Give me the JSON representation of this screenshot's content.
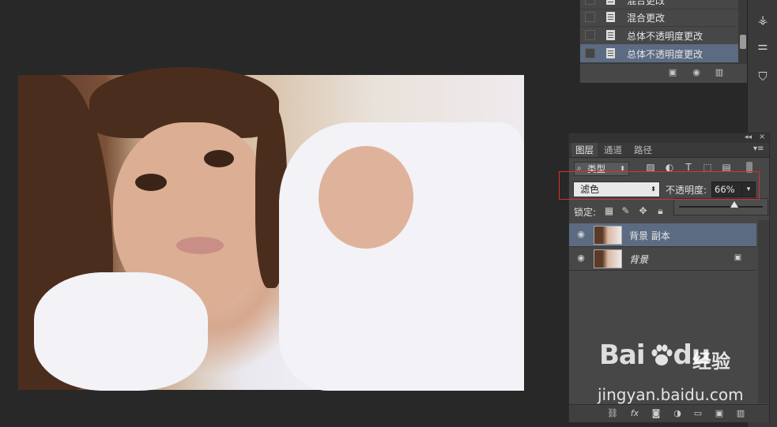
{
  "history": {
    "items": [
      {
        "label": "混合更改",
        "selected": false
      },
      {
        "label": "混合更改",
        "selected": false
      },
      {
        "label": "总体不透明度更改",
        "selected": false
      },
      {
        "label": "总体不透明度更改",
        "selected": true
      }
    ],
    "footer_icons": [
      "new-document-from-state-icon",
      "camera-icon",
      "trash-icon"
    ]
  },
  "layers_panel": {
    "tabs": [
      {
        "label": "图层",
        "active": true
      },
      {
        "label": "通道",
        "active": false
      },
      {
        "label": "路径",
        "active": false
      }
    ],
    "filter_kind": "类型",
    "filter_icons": [
      "image-filter-icon",
      "adjustment-filter-icon",
      "type-filter-icon",
      "shape-filter-icon",
      "smart-object-filter-icon"
    ],
    "blend_mode": "滤色",
    "opacity_label": "不透明度:",
    "opacity_value": "66%",
    "opacity_fraction": 0.66,
    "lock_label": "锁定:",
    "layers": [
      {
        "name": "背景 副本",
        "selected": true,
        "locked": false
      },
      {
        "name": "背景",
        "selected": false,
        "locked": true
      }
    ],
    "footer_icons": [
      "link-icon",
      "fx-icon",
      "mask-icon",
      "adjustment-icon",
      "folder-icon",
      "new-layer-icon",
      "trash-icon"
    ]
  },
  "watermark": {
    "logo_text_left": "Bai",
    "logo_text_right": "du",
    "service": "经验",
    "url": "jingyan.baidu.com"
  },
  "colors": {
    "background": "#282828",
    "panel": "#474747",
    "selection": "#5b6b82",
    "highlight": "#d8312b"
  }
}
